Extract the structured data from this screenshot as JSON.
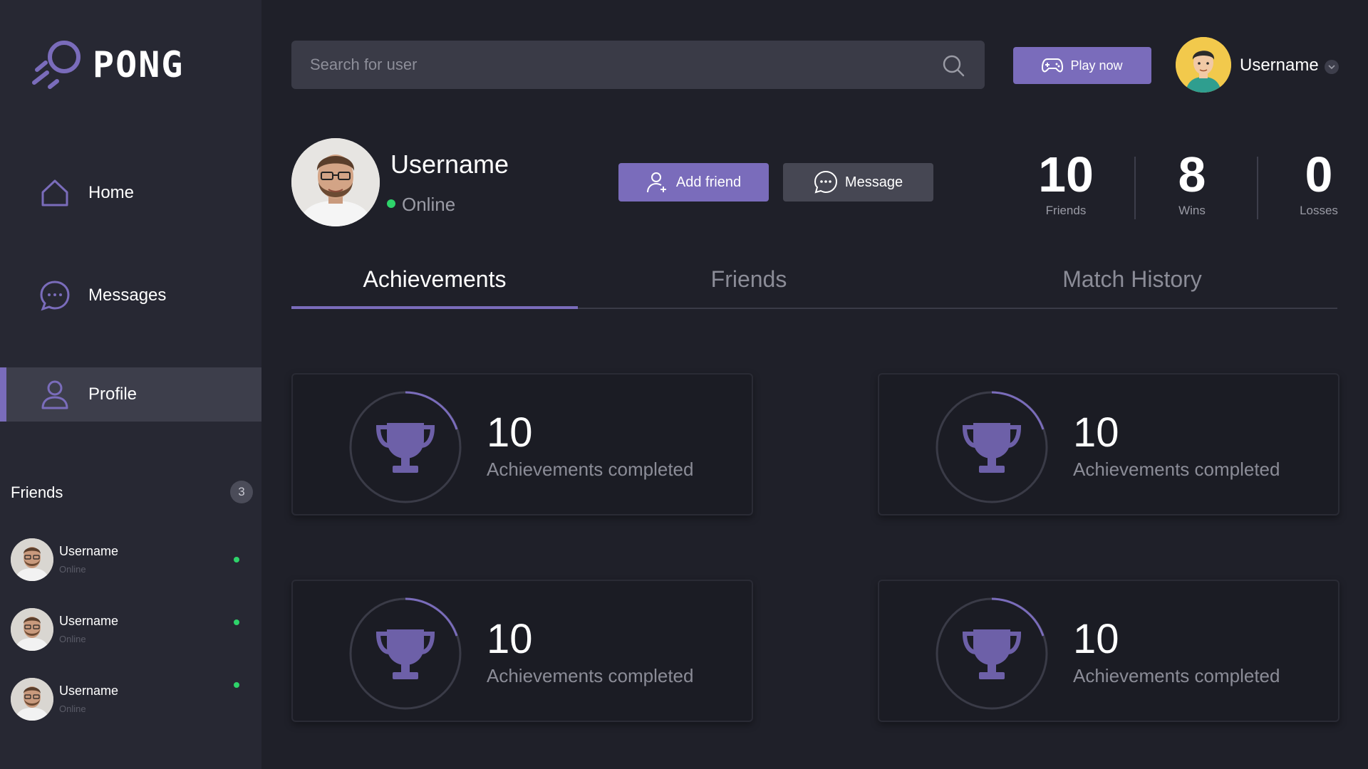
{
  "app": {
    "logo_text": "PONG"
  },
  "colors": {
    "accent": "#7a6cbb",
    "online": "#2ed36a",
    "background": "#1f2029",
    "sidebar": "#272833"
  },
  "sidebar": {
    "items": [
      {
        "label": "Home",
        "icon": "home-icon"
      },
      {
        "label": "Messages",
        "icon": "chat-icon"
      },
      {
        "label": "Profile",
        "icon": "user-icon",
        "active": true
      }
    ],
    "friends": {
      "title": "Friends",
      "count": "3",
      "list": [
        {
          "name": "Username",
          "status": "Online"
        },
        {
          "name": "Username",
          "status": "Online"
        },
        {
          "name": "Username",
          "status": "Online"
        }
      ]
    }
  },
  "header": {
    "search_placeholder": "Search for user",
    "play_label": "Play now",
    "user_name": "Username"
  },
  "profile": {
    "name": "Username",
    "status": "Online",
    "add_friend_label": "Add friend",
    "message_label": "Message",
    "stats": [
      {
        "value": "10",
        "label": "Friends"
      },
      {
        "value": "8",
        "label": "Wins"
      },
      {
        "value": "0",
        "label": "Losses"
      }
    ]
  },
  "tabs": [
    {
      "label": "Achievements",
      "active": true
    },
    {
      "label": "Friends"
    },
    {
      "label": "Match History"
    }
  ],
  "achievements": [
    {
      "value": "10",
      "label": "Achievements completed"
    },
    {
      "value": "10",
      "label": "Achievements completed"
    },
    {
      "value": "10",
      "label": "Achievements completed"
    },
    {
      "value": "10",
      "label": "Achievements completed"
    }
  ]
}
